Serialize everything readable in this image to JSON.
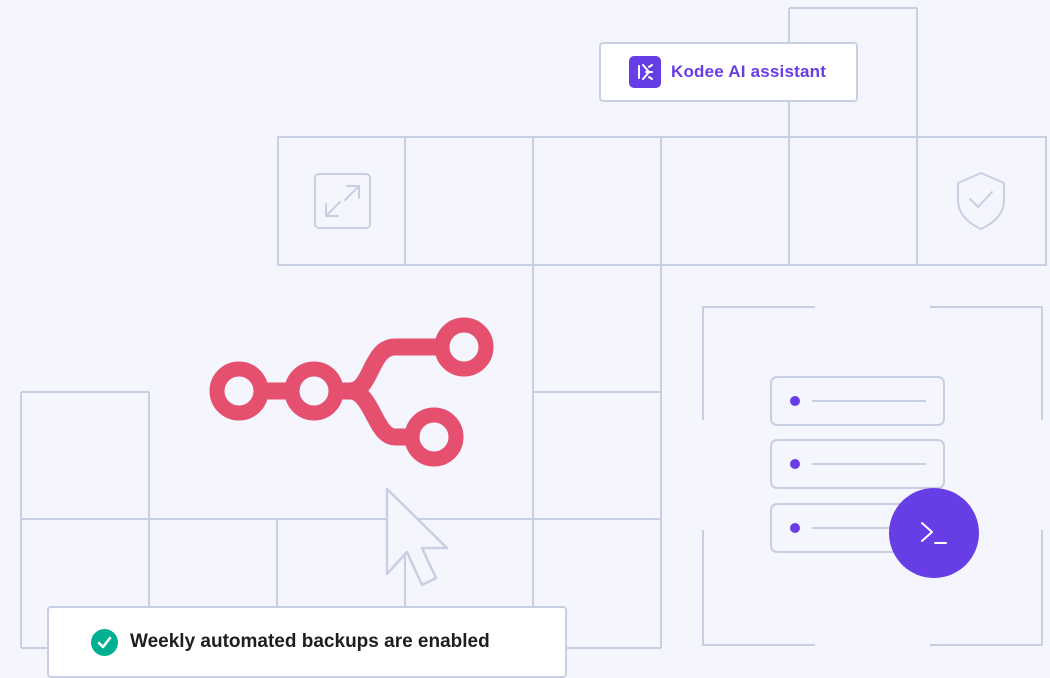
{
  "assistant_card": {
    "label": "Kodee AI assistant",
    "icon": "kodee-logo-icon"
  },
  "notification": {
    "label": "Weekly automated backups are enabled",
    "icon": "check-circle-icon"
  },
  "terminal_button": {
    "icon": "terminal-prompt-icon"
  },
  "illustration": {
    "icons": [
      "expand-icon",
      "shield-check-icon",
      "git-branch-icon",
      "cursor-pointer-icon"
    ],
    "list_items": 3
  },
  "colors": {
    "background": "#f4f5fd",
    "grid_line": "#c9cfe3",
    "brand_purple": "#673de6",
    "branch_pink": "#e5506f",
    "success_green": "#00b090",
    "text_dark": "#1d1e20"
  }
}
